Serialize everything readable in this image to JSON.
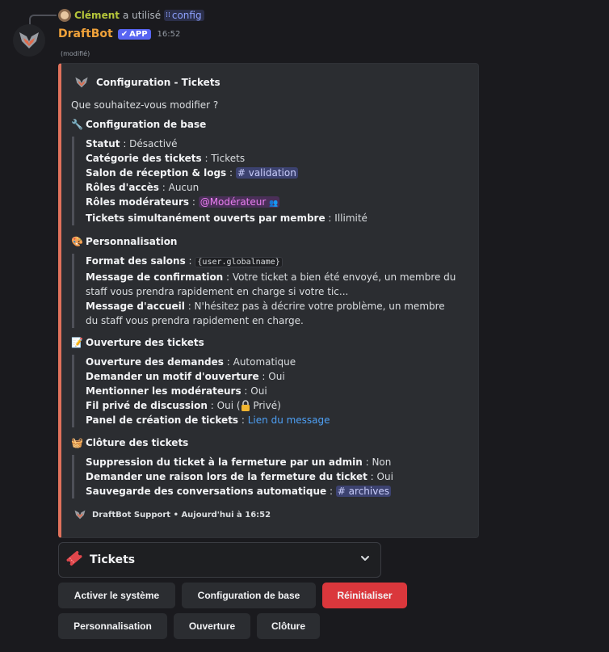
{
  "reply": {
    "user": "Clément",
    "used_text": "a utilisé",
    "command": "config"
  },
  "header": {
    "bot_name": "DraftBot",
    "badge": "APP",
    "time": "16:52",
    "edited": "(modifié)"
  },
  "embed": {
    "accent_color": "#e0725c",
    "author": "Configuration - Tickets",
    "description": "Que souhaitez-vous modifier ?",
    "sections": {
      "base": {
        "title": "Configuration de base",
        "statut_label": "Statut",
        "statut_value": "Désactivé",
        "categorie_label": "Catégorie des tickets",
        "categorie_value": "Tickets",
        "salon_label": "Salon de réception & logs",
        "salon_value": "validation",
        "roles_acces_label": "Rôles d'accès",
        "roles_acces_value": "Aucun",
        "roles_mod_label": "Rôles modérateurs",
        "roles_mod_value": "@Modérateur",
        "simult_label": "Tickets simultanément ouverts par membre",
        "simult_value": "Illimité"
      },
      "perso": {
        "title": "Personnalisation",
        "format_label": "Format des salons",
        "format_value": "{user.globalname}",
        "confirm_label": "Message de confirmation",
        "confirm_value": "Votre ticket a bien été envoyé, un membre du staff vous prendra rapidement en charge si votre tic...",
        "accueil_label": "Message d'accueil",
        "accueil_value": "N'hésitez pas à décrire votre problème, un membre du staff vous prendra rapidement en charge."
      },
      "ouverture": {
        "title": "Ouverture des tickets",
        "demandes_label": "Ouverture des demandes",
        "demandes_value": "Automatique",
        "motif_label": "Demander un motif d'ouverture",
        "motif_value": "Oui",
        "mention_label": "Mentionner les modérateurs",
        "mention_value": "Oui",
        "fil_label": "Fil privé de discussion",
        "fil_value_pre": "Oui (",
        "fil_value_post": " Privé)",
        "panel_label": "Panel de création de tickets",
        "panel_value": "Lien du message"
      },
      "cloture": {
        "title": "Clôture des tickets",
        "suppr_label": "Suppression du ticket à la fermeture par un admin",
        "suppr_value": "Non",
        "raison_label": "Demander une raison lors de la fermeture du ticket",
        "raison_value": "Oui",
        "sauvegarde_label": "Sauvegarde des conversations automatique",
        "sauvegarde_value": "archives"
      }
    },
    "footer": "DraftBot Support • Aujourd'hui à 16:52"
  },
  "select": {
    "label": "Tickets",
    "icon": "ticket-icon"
  },
  "buttons": {
    "activer": "Activer le système",
    "config_base": "Configuration de base",
    "reinit": "Réinitialiser",
    "perso": "Personnalisation",
    "ouverture": "Ouverture",
    "cloture": "Clôture"
  }
}
